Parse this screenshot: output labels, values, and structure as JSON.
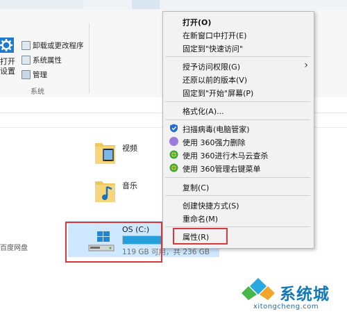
{
  "ribbon": {
    "items": [
      {
        "label": "卸载或更改程序"
      },
      {
        "label": "系统属性"
      },
      {
        "label": "管理"
      }
    ],
    "big_button_line1": "打开",
    "big_button_line2": "设置",
    "group_label": "系统"
  },
  "folders": [
    {
      "label": "视频"
    },
    {
      "label": "音乐"
    }
  ],
  "sidebar": {
    "baidu_label": "百度网盘"
  },
  "drive": {
    "name": "OS (C:)",
    "space": "119 GB 可用，共 236 GB",
    "used_fraction": 0.5
  },
  "context_menu": {
    "items": [
      {
        "label": "打开(O)",
        "bold": true
      },
      {
        "label": "在新窗口中打开(E)"
      },
      {
        "label": "固定到\"快速访问\""
      },
      {
        "label": "授予访问权限(G)",
        "submenu": true
      },
      {
        "label": "还原以前的版本(V)"
      },
      {
        "label": "固定到\"开始\"屏幕(P)"
      },
      {
        "label": "格式化(A)..."
      },
      {
        "label": "扫描病毒(电脑管家)"
      },
      {
        "label": "使用 360强力删除"
      },
      {
        "label": "使用 360进行木马云查杀"
      },
      {
        "label": "使用 360管理右键菜单"
      },
      {
        "label": "复制(C)"
      },
      {
        "label": "创建快捷方式(S)"
      },
      {
        "label": "重命名(M)"
      },
      {
        "label": "属性(R)"
      }
    ],
    "submenu_arrow": "›"
  },
  "watermark": {
    "text": "系统城",
    "url": "xitongcheng.com"
  },
  "colors": {
    "highlight_red": "#d9373a",
    "selection_blue": "#cde8ff",
    "drive_bar_blue": "#26a0da",
    "watermark_blue": "#1279b8"
  }
}
